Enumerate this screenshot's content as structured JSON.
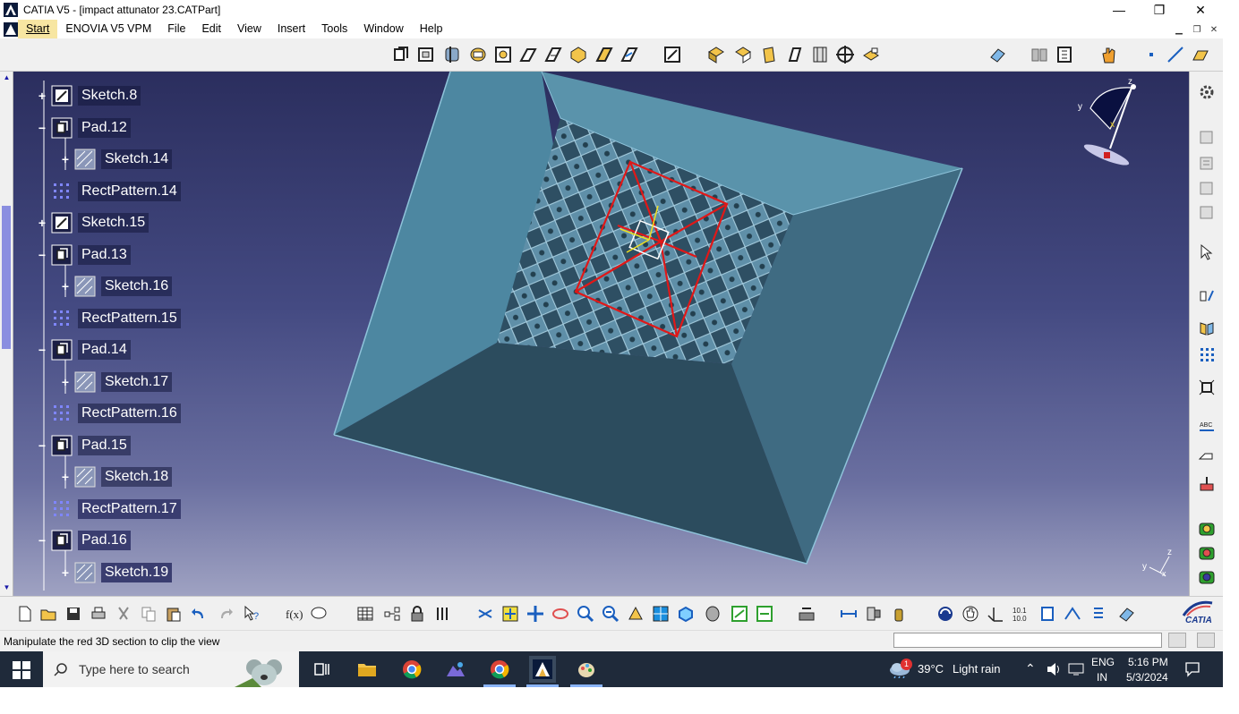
{
  "window": {
    "title": "CATIA V5 - [impact attunator 23.CATPart]",
    "controls": {
      "minimize": "—",
      "restore": "❐",
      "close": "✕"
    }
  },
  "menu": {
    "start": "Start",
    "enovia": "ENOVIA V5 VPM",
    "file": "File",
    "edit": "Edit",
    "view": "View",
    "insert": "Insert",
    "tools": "Tools",
    "window": "Window",
    "help": "Help"
  },
  "tree": {
    "nodes": [
      {
        "label": "Sketch.8",
        "type": "sketch",
        "expander": "+",
        "indent": 0
      },
      {
        "label": "Pad.12",
        "type": "pad",
        "expander": "−",
        "indent": 0
      },
      {
        "label": "Sketch.14",
        "type": "sketch-sub",
        "expander": "+",
        "indent": 1
      },
      {
        "label": "RectPattern.14",
        "type": "pattern",
        "expander": "",
        "indent": 0
      },
      {
        "label": "Sketch.15",
        "type": "sketch",
        "expander": "+",
        "indent": 0
      },
      {
        "label": "Pad.13",
        "type": "pad",
        "expander": "−",
        "indent": 0
      },
      {
        "label": "Sketch.16",
        "type": "sketch-sub",
        "expander": "+",
        "indent": 1
      },
      {
        "label": "RectPattern.15",
        "type": "pattern",
        "expander": "",
        "indent": 0
      },
      {
        "label": "Pad.14",
        "type": "pad",
        "expander": "−",
        "indent": 0
      },
      {
        "label": "Sketch.17",
        "type": "sketch-sub",
        "expander": "+",
        "indent": 1
      },
      {
        "label": "RectPattern.16",
        "type": "pattern",
        "expander": "",
        "indent": 0
      },
      {
        "label": "Pad.15",
        "type": "pad",
        "expander": "−",
        "indent": 0
      },
      {
        "label": "Sketch.18",
        "type": "sketch-sub",
        "expander": "+",
        "indent": 1
      },
      {
        "label": "RectPattern.17",
        "type": "pattern",
        "expander": "",
        "indent": 0,
        "selected": true
      },
      {
        "label": "Pad.16",
        "type": "pad",
        "expander": "−",
        "indent": 0,
        "selected": true
      },
      {
        "label": "Sketch.19",
        "type": "sketch-sub",
        "expander": "+",
        "indent": 1,
        "selected": true
      }
    ]
  },
  "compass": {
    "axis_x": "x",
    "axis_y": "y",
    "axis_z": "z"
  },
  "triad": {
    "axis_y": "y",
    "axis_x": "x",
    "axis_z": "z"
  },
  "status": {
    "message": "Manipulate the red 3D section to clip the view",
    "command_value": ""
  },
  "catia_logo": "CATIA",
  "taskbar": {
    "search_placeholder": "Type here to search",
    "weather_temp": "39°C",
    "weather_desc": "Light rain",
    "weather_badge": "1",
    "lang_top": "ENG",
    "lang_bottom": "IN",
    "time": "5:16 PM",
    "date": "5/3/2024"
  },
  "colors": {
    "viewport_top": "#2b2e5e",
    "viewport_bottom": "#9fa2c2",
    "part_face": "#3e6f84",
    "clip_section": "#e01818",
    "start_highlight": "#f7e6a2"
  }
}
